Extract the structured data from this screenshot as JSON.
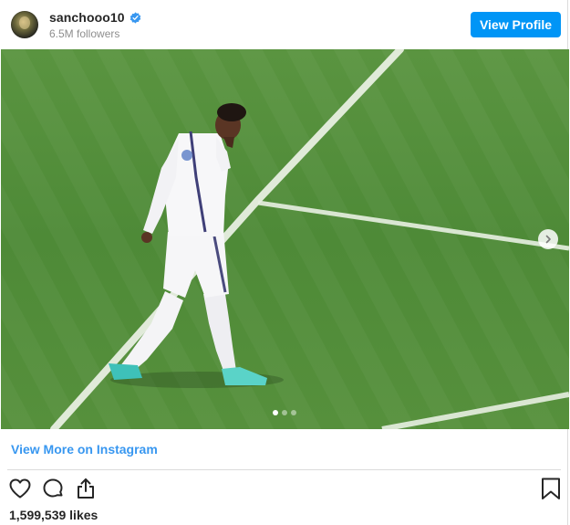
{
  "post": {
    "username": "sanchooo10",
    "followers": "6.5M followers",
    "view_profile_label": "View Profile",
    "view_more_label": "View More on Instagram",
    "likes": "1,599,539 likes"
  },
  "carousel": {
    "total_slides": 3,
    "active_slide": 1
  },
  "icons": {
    "verified": "verified-badge-icon",
    "next": "chevron-right-icon",
    "like": "heart-icon",
    "comment": "comment-bubble-icon",
    "share": "share-icon",
    "save": "bookmark-icon"
  },
  "colors": {
    "accent_button": "#0095f6",
    "link": "#3897f0",
    "verified": "#3897f0",
    "text": "#262626",
    "muted": "#8e8e8e"
  }
}
